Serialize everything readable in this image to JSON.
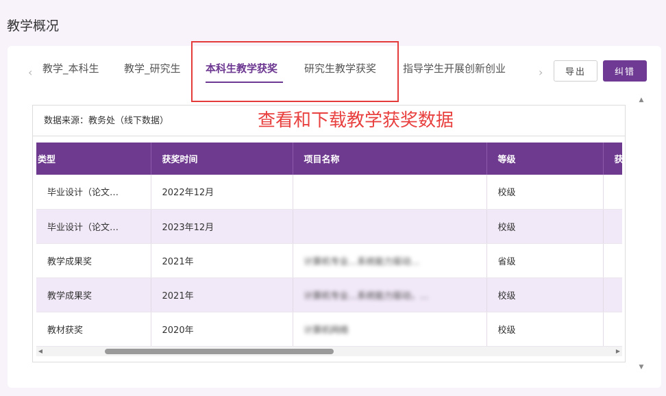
{
  "page_title": "教学概况",
  "tabs": [
    {
      "label": "教学_本科生"
    },
    {
      "label": "教学_研究生"
    },
    {
      "label": "本科生教学获奖"
    },
    {
      "label": "研究生教学获奖"
    },
    {
      "label": "指导学生开展创新创业"
    }
  ],
  "toolbar": {
    "export_label": "导出",
    "correct_label": "纠错"
  },
  "source_label": "数据来源：教务处（线下数据）",
  "annotation": "查看和下载教学获奖数据",
  "table": {
    "headers": [
      "类型",
      "获奖时间",
      "项目名称",
      "等级",
      "获"
    ],
    "rows": [
      {
        "type": "毕业设计（论文…",
        "time": "2022年12月",
        "name": "",
        "level": "校级"
      },
      {
        "type": "毕业设计（论文…",
        "time": "2023年12月",
        "name": "",
        "level": "校级"
      },
      {
        "type": "教学成果奖",
        "time": "2021年",
        "name": "计算机专业…系统能力驱动…",
        "level": "省级"
      },
      {
        "type": "教学成果奖",
        "time": "2021年",
        "name": "计算机专业…系统能力驱动，…",
        "level": "校级"
      },
      {
        "type": "教材获奖",
        "time": "2020年",
        "name": "计算机网络",
        "level": "校级"
      }
    ]
  },
  "colors": {
    "accent": "#6e3a93",
    "highlight": "#e53a3a",
    "annotation": "#e8403e"
  },
  "icons": {
    "prev": "chevron-left-icon",
    "next": "chevron-right-icon"
  }
}
